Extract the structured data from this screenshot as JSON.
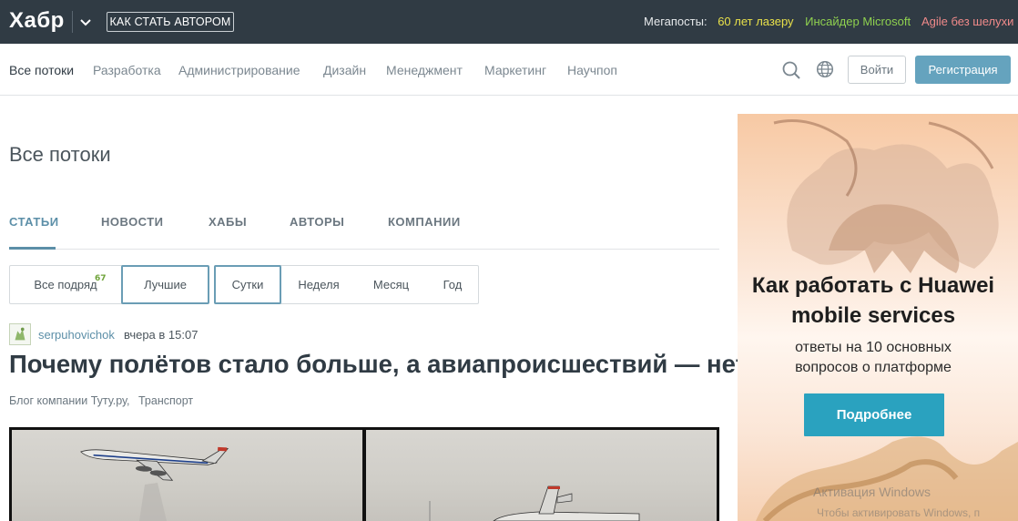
{
  "header": {
    "logo": "Хабр",
    "become_author": "КАК СТАТЬ АВТОРОМ",
    "megaposts_label": "Мегапосты:",
    "megaposts": [
      {
        "label": "60 лет лазеру",
        "color": "#e8e04a"
      },
      {
        "label": "Инсайдер Microsoft",
        "color": "#8fd14f"
      },
      {
        "label": "Agile без шелухи",
        "color": "#f08a8a"
      }
    ]
  },
  "nav": {
    "items": [
      "Все потоки",
      "Разработка",
      "Администрирование",
      "Дизайн",
      "Менеджмент",
      "Маркетинг",
      "Научпоп"
    ],
    "active_index": 0,
    "login": "Войти",
    "register": "Регистрация",
    "icons": [
      "search-icon",
      "globe-icon"
    ]
  },
  "main": {
    "title": "Все потоки",
    "tabs": [
      "СТАТЬИ",
      "НОВОСТИ",
      "ХАБЫ",
      "АВТОРЫ",
      "КОМПАНИИ"
    ],
    "active_tab": 0,
    "filters_rating": [
      {
        "label": "Все подряд",
        "badge": "67"
      },
      {
        "label": "Лучшие",
        "selected": true
      }
    ],
    "filters_period": [
      {
        "label": "Сутки",
        "selected": true
      },
      {
        "label": "Неделя"
      },
      {
        "label": "Месяц"
      },
      {
        "label": "Год"
      }
    ]
  },
  "post": {
    "author": "serpuhovichok",
    "time": "вчера в 15:07",
    "title": "Почему полётов стало больше, а авиапроисшествий — нет",
    "hubs": [
      "Блог компании Туту.ру,",
      "Транспорт"
    ]
  },
  "ad": {
    "title_line1": "Как работать с Huawei",
    "title_line2": "mobile services",
    "subtitle_line1": "ответы на 10 основных",
    "subtitle_line2": "вопросов о платформе",
    "button": "Подробнее"
  },
  "watermark": {
    "line1": "Активация Windows",
    "line2": "Чтобы активировать Windows, п"
  }
}
